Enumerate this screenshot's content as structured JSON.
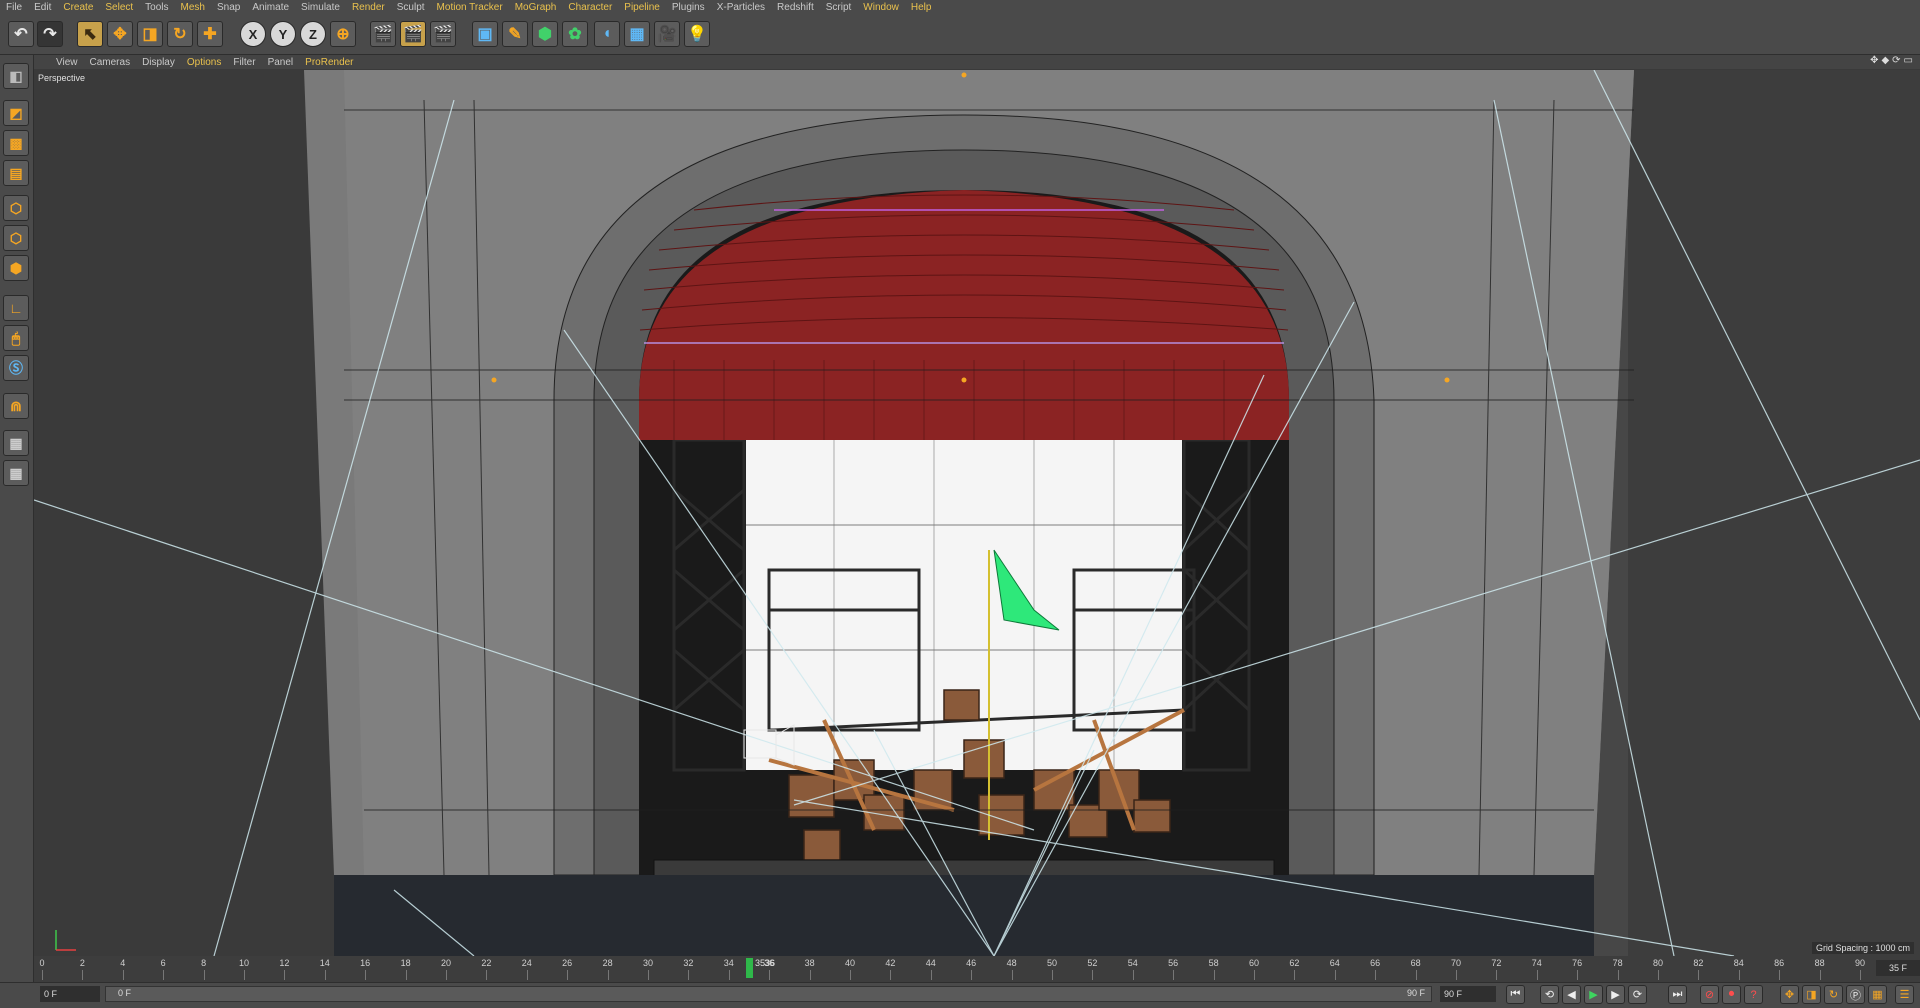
{
  "menu": [
    "File",
    "Edit",
    "Create",
    "Select",
    "Tools",
    "Mesh",
    "Snap",
    "Animate",
    "Simulate",
    "Render",
    "Sculpt",
    "Motion Tracker",
    "MoGraph",
    "Character",
    "Pipeline",
    "Plugins",
    "X-Particles",
    "Redshift",
    "Script",
    "Window",
    "Help"
  ],
  "viewport_menu": [
    "View",
    "Cameras",
    "Display",
    "Options",
    "Filter",
    "Panel",
    "ProRender"
  ],
  "viewport": {
    "label": "Perspective",
    "grid_spacing": "Grid Spacing : 1000 cm"
  },
  "toolbar": {
    "x_axis": "X",
    "y_axis": "Y",
    "z_axis": "Z"
  },
  "timeline": {
    "ticks": [
      "0",
      "2",
      "4",
      "6",
      "8",
      "10",
      "12",
      "14",
      "16",
      "18",
      "20",
      "22",
      "24",
      "26",
      "28",
      "30",
      "32",
      "34",
      "36",
      "38",
      "40",
      "42",
      "44",
      "46",
      "48",
      "50",
      "52",
      "54",
      "56",
      "58",
      "60",
      "62",
      "64",
      "66",
      "68",
      "70",
      "72",
      "74",
      "76",
      "78",
      "80",
      "82",
      "84",
      "86",
      "88",
      "90"
    ],
    "current_frame_label": "3536",
    "current_frame": 35,
    "end_field": "35 F"
  },
  "bottom": {
    "start_field": "0 F",
    "range_start": "0 F",
    "range_end": "90 F",
    "end_field": "90 F"
  },
  "colors": {
    "accent": "#e9c14d",
    "curtain": "#8b2323",
    "flag": "#2ee87a",
    "playhead": "#2fb84a"
  }
}
